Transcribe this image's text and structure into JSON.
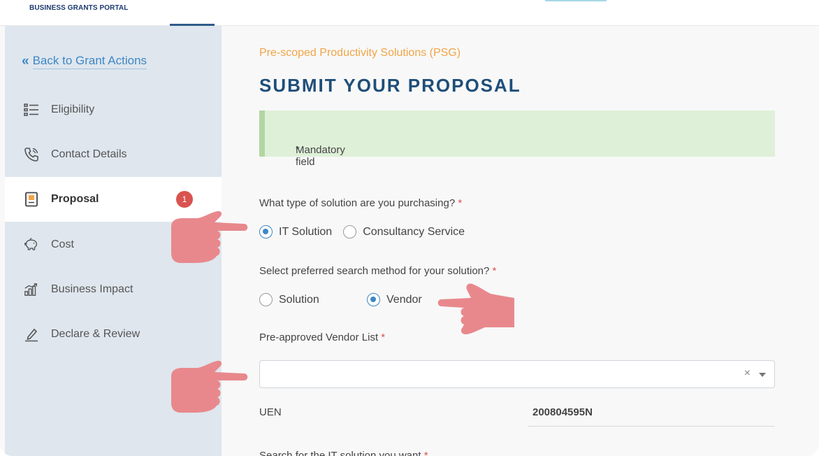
{
  "header": {
    "brand": "BUSINESS GRANTS PORTAL"
  },
  "sidebar": {
    "back_label": "Back to Grant Actions",
    "items": [
      {
        "label": "Eligibility",
        "icon": "list-icon"
      },
      {
        "label": "Contact Details",
        "icon": "phone-icon"
      },
      {
        "label": "Proposal",
        "icon": "document-icon",
        "badge": "1",
        "active": true
      },
      {
        "label": "Cost",
        "icon": "piggy-bank-icon"
      },
      {
        "label": "Business Impact",
        "icon": "bar-chart-icon"
      },
      {
        "label": "Declare & Review",
        "icon": "signature-pen-icon"
      }
    ]
  },
  "main": {
    "subtitle": "Pre-scoped Productivity Solutions (PSG)",
    "title": "SUBMIT YOUR PROPOSAL",
    "mandatory_note": "Mandatory field",
    "required_mark": "*",
    "q1": {
      "label": "What type of solution are you purchasing?",
      "options": [
        "IT Solution",
        "Consultancy Service"
      ],
      "selected": "IT Solution"
    },
    "q2": {
      "label": "Select preferred search method for your solution?",
      "options": [
        "Solution",
        "Vendor"
      ],
      "selected": "Vendor"
    },
    "vendor_list": {
      "label": "Pre-approved Vendor List",
      "value": "",
      "clear_symbol": "×"
    },
    "uen": {
      "label": "UEN",
      "value": "200804595N"
    },
    "next_question": "Search for the IT solution you want"
  },
  "colors": {
    "accent": "#3d87c5",
    "title": "#1f4e79",
    "subtitle": "#f0a547",
    "badge": "#d9534f",
    "mandatory_bg": "#dff0d8",
    "hand": "#e8888c"
  }
}
